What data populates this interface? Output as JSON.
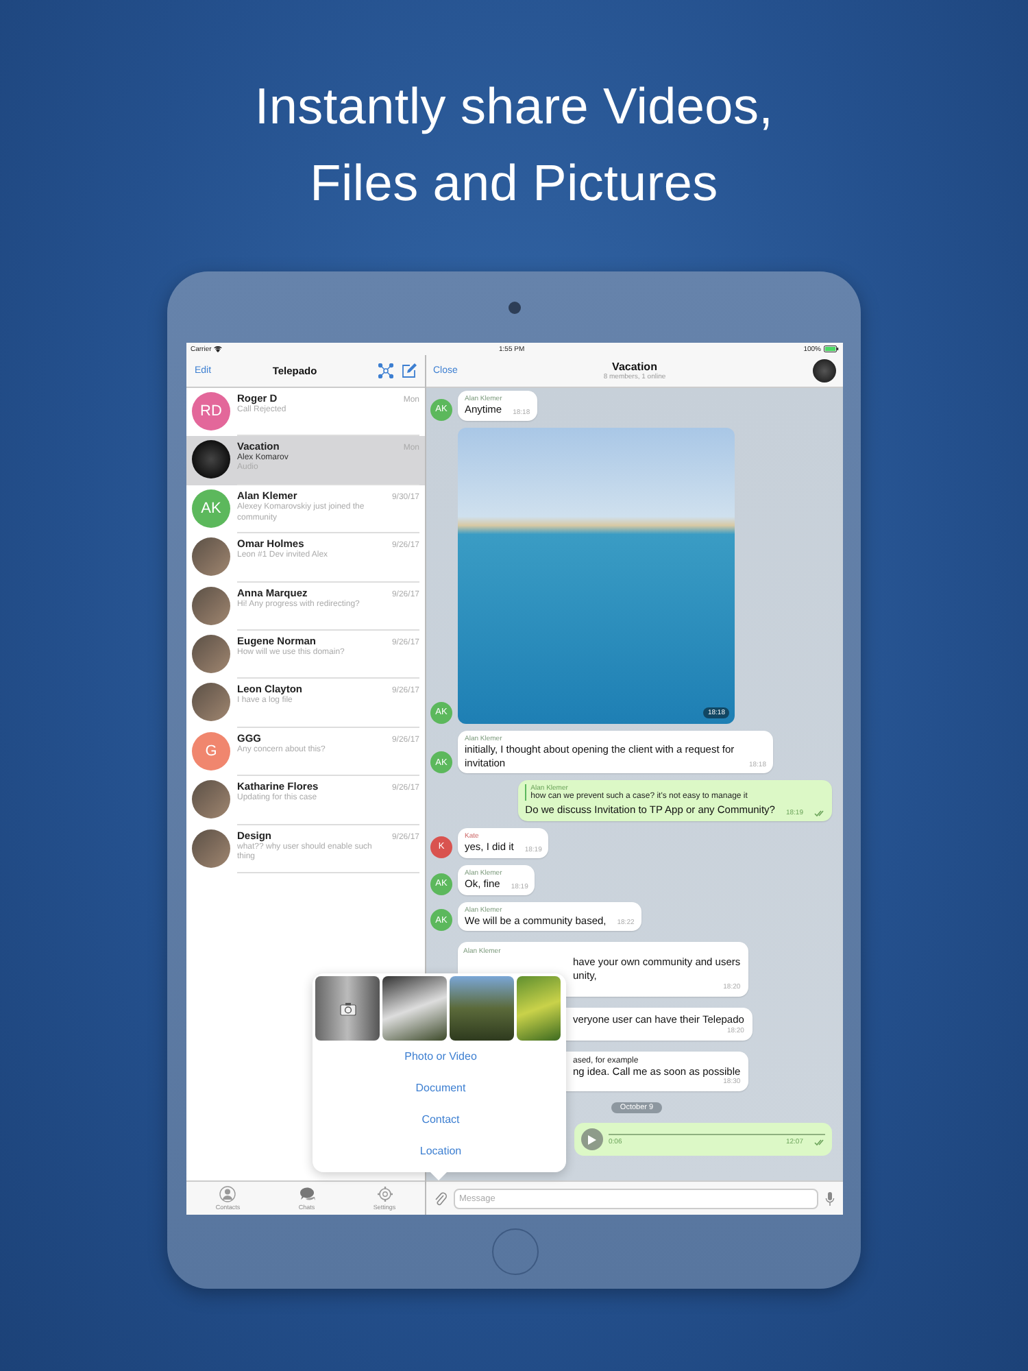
{
  "headline": [
    "Instantly share Videos,",
    "Files and Pictures"
  ],
  "status_bar": {
    "carrier": "Carrier",
    "time": "1:55 PM",
    "battery": "100%"
  },
  "sidebar": {
    "edit": "Edit",
    "title": "Telepado"
  },
  "chats": [
    {
      "name": "Roger D",
      "preview": "Call Rejected",
      "date": "Mon",
      "selected": false,
      "avatar": {
        "kind": "initials",
        "initials": "RD",
        "color": "#e3679a"
      }
    },
    {
      "name": "Vacation",
      "sender": "Alex Komarov",
      "preview": "Audio",
      "date": "Mon",
      "selected": true,
      "avatar": {
        "kind": "photo"
      }
    },
    {
      "name": "Alan Klemer",
      "preview": "Alexey Komarovskiy just joined the community",
      "date": "9/30/17",
      "selected": false,
      "avatar": {
        "kind": "initials",
        "initials": "AK",
        "color": "#5cb85c"
      }
    },
    {
      "name": "Omar Holmes",
      "preview": "Leon #1 Dev invited Alex",
      "date": "9/26/17",
      "selected": false,
      "avatar": {
        "kind": "photo"
      }
    },
    {
      "name": "Anna Marquez",
      "preview": "Hi! Any progress with redirecting?",
      "date": "9/26/17",
      "selected": false,
      "avatar": {
        "kind": "photo"
      }
    },
    {
      "name": "Eugene Norman",
      "preview": "How will we use this domain?",
      "date": "9/26/17",
      "selected": false,
      "avatar": {
        "kind": "photo"
      }
    },
    {
      "name": "Leon Clayton",
      "preview": "I have a log file",
      "date": "9/26/17",
      "selected": false,
      "avatar": {
        "kind": "photo"
      }
    },
    {
      "name": "GGG",
      "preview": "Any concern about this?",
      "date": "9/26/17",
      "selected": false,
      "avatar": {
        "kind": "initials",
        "initials": "G",
        "color": "#f0866e"
      }
    },
    {
      "name": "Katharine Flores",
      "preview": "Updating for this case",
      "date": "9/26/17",
      "selected": false,
      "avatar": {
        "kind": "photo"
      }
    },
    {
      "name": "Design",
      "preview": "what?? why user should enable such thing",
      "date": "9/26/17",
      "selected": false,
      "avatar": {
        "kind": "photo"
      }
    }
  ],
  "tab_bar": [
    "Contacts",
    "Chats",
    "Settings"
  ],
  "chat": {
    "close": "Close",
    "title": "Vacation",
    "subtitle": "8 members, 1 online"
  },
  "messages": [
    {
      "kind": "incoming",
      "sender": "Alan Klemer",
      "text": "Anytime",
      "time": "18:18",
      "avatar": {
        "initials": "AK",
        "color": "#5cb85c"
      }
    },
    {
      "kind": "photo",
      "time": "18:18",
      "avatar": {
        "initials": "AK",
        "color": "#5cb85c"
      }
    },
    {
      "kind": "incoming",
      "sender": "Alan Klemer",
      "text": "initially, I thought about opening the client with a request for invitation",
      "time": "18:18",
      "avatar": {
        "initials": "AK",
        "color": "#5cb85c"
      }
    },
    {
      "kind": "outgoing",
      "reply_sender": "Alan Klemer",
      "reply_text": "how can we prevent such a case? it's not easy to manage it",
      "text": "Do we discuss Invitation to TP App or any Community?",
      "time": "18:19"
    },
    {
      "kind": "incoming",
      "sender": "Kate",
      "text": "yes, I did it",
      "time": "18:19",
      "avatar": {
        "initials": "K",
        "color": "#d9534f"
      }
    },
    {
      "kind": "incoming",
      "sender": "Alan Klemer",
      "text": "Ok, fine",
      "time": "18:19",
      "avatar": {
        "initials": "AK",
        "color": "#5cb85c"
      }
    },
    {
      "kind": "incoming",
      "sender": "Alan Klemer",
      "text": "We will be a community based,",
      "time": "18:22",
      "avatar": {
        "initials": "AK",
        "color": "#5cb85c"
      }
    },
    {
      "kind": "covered",
      "sender": "Alan Klemer",
      "lines": [
        "have your own community and users",
        "unity,"
      ],
      "time": "18:20"
    },
    {
      "kind": "covered",
      "lines": [
        "veryone user can have their Telepado"
      ],
      "time": "18:20"
    },
    {
      "kind": "covered",
      "reply_text": "ased, for example",
      "lines": [
        "ng idea. Call me as soon as possible"
      ],
      "time": "18:30"
    },
    {
      "kind": "date",
      "text": "October 9"
    },
    {
      "kind": "voice",
      "duration": "0:06",
      "time": "12:07"
    }
  ],
  "attach_menu": {
    "thumbnails": [
      {
        "kind": "camera"
      },
      {
        "kind": "photo"
      },
      {
        "kind": "photo"
      },
      {
        "kind": "photo"
      }
    ],
    "items": [
      "Photo or Video",
      "Document",
      "Contact",
      "Location"
    ]
  },
  "composer": {
    "placeholder": "Message"
  }
}
